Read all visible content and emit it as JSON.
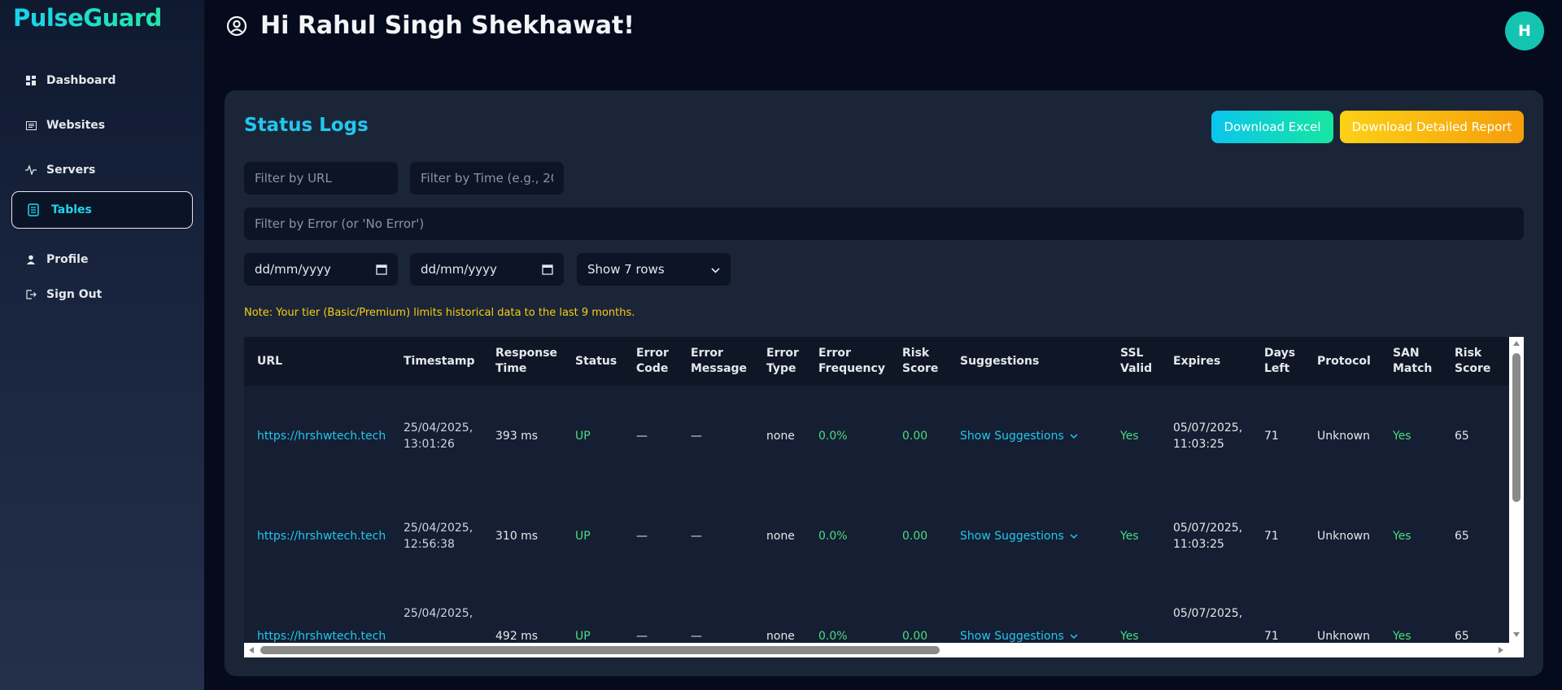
{
  "app": {
    "name": "PulseGuard"
  },
  "sidebar": {
    "items": [
      {
        "label": "Dashboard",
        "icon": "dashboard-icon",
        "active": false
      },
      {
        "label": "Websites",
        "icon": "websites-icon",
        "active": false
      },
      {
        "label": "Servers",
        "icon": "activity-icon",
        "active": false
      },
      {
        "label": "Tables",
        "icon": "document-icon",
        "active": true
      },
      {
        "label": "Profile",
        "icon": "user-icon",
        "active": false
      },
      {
        "label": "Sign Out",
        "icon": "sign-out-icon",
        "active": false
      }
    ]
  },
  "header": {
    "greeting": "Hi Rahul Singh Shekhawat!",
    "avatar_initial": "H"
  },
  "card": {
    "title": "Status Logs",
    "download_excel": "Download Excel",
    "download_report": "Download Detailed Report"
  },
  "filters": {
    "url_placeholder": "Filter by URL",
    "time_placeholder": "Filter by Time (e.g., 20",
    "error_placeholder": "Filter by Error (or 'No Error')",
    "date_from": "dd/mm/yyyy",
    "date_to": "dd/mm/yyyy",
    "rows_select": "Show 7 rows"
  },
  "note": "Note: Your tier (Basic/Premium) limits historical data to the last 9 months.",
  "table": {
    "columns": [
      "URL",
      "Timestamp",
      "Response Time",
      "Status",
      "Error Code",
      "Error Message",
      "Error Type",
      "Error Frequency",
      "Risk Score",
      "Suggestions",
      "SSL Valid",
      "Expires",
      "Days Left",
      "Protocol",
      "SAN Match",
      "Risk Score"
    ],
    "rows": [
      {
        "url": "https://hrshwtech.tech",
        "timestamp": "25/04/2025, 13:01:26",
        "response_time": "393 ms",
        "status": "UP",
        "error_code": "—",
        "error_message": "—",
        "error_type": "none",
        "error_frequency": "0.0%",
        "risk_score": "0.00",
        "suggestions": "Show Suggestions",
        "ssl_valid": "Yes",
        "expires": "05/07/2025, 11:03:25",
        "days_left": "71",
        "protocol": "Unknown",
        "san_match": "Yes",
        "risk_score2": "65"
      },
      {
        "url": "https://hrshwtech.tech",
        "timestamp": "25/04/2025, 12:56:38",
        "response_time": "310 ms",
        "status": "UP",
        "error_code": "—",
        "error_message": "—",
        "error_type": "none",
        "error_frequency": "0.0%",
        "risk_score": "0.00",
        "suggestions": "Show Suggestions",
        "ssl_valid": "Yes",
        "expires": "05/07/2025, 11:03:25",
        "days_left": "71",
        "protocol": "Unknown",
        "san_match": "Yes",
        "risk_score2": "65"
      },
      {
        "url": "https://hrshwtech.tech",
        "timestamp": "25/04/2025,",
        "response_time": "492 ms",
        "status": "UP",
        "error_code": "—",
        "error_message": "—",
        "error_type": "none",
        "error_frequency": "0.0%",
        "risk_score": "0.00",
        "suggestions": "Show Suggestions",
        "ssl_valid": "Yes",
        "expires": "05/07/2025,",
        "days_left": "71",
        "protocol": "Unknown",
        "san_match": "Yes",
        "risk_score2": "65"
      }
    ]
  },
  "colors": {
    "accent": "#22c7ee",
    "success": "#4ade80",
    "warning": "#facc15",
    "avatar": "#14c4b0"
  }
}
